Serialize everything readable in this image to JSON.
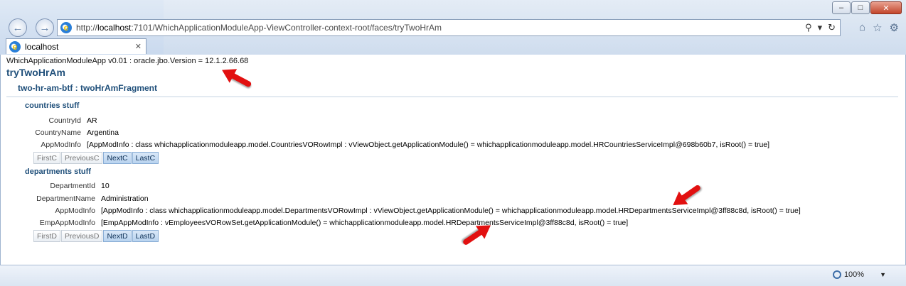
{
  "browser": {
    "url_prefix": "http://",
    "url_host": "localhost",
    "url_rest": ":7101/WhichApplicationModuleApp-ViewController-context-root/faces/tryTwoHrAm",
    "tab_label": "localhost",
    "zoom": "100%"
  },
  "page": {
    "version_line": "WhichApplicationModuleApp v0.01 : oracle.jbo.Version = 12.1.2.66.68",
    "title": "tryTwoHrAm",
    "btf_title": "two-hr-am-btf : twoHrAmFragment"
  },
  "countries": {
    "title": "countries stuff",
    "fields": [
      {
        "label": "CountryId",
        "value": "AR"
      },
      {
        "label": "CountryName",
        "value": "Argentina"
      },
      {
        "label": "AppModInfo",
        "value": "[AppModInfo : class whichapplicationmoduleapp.model.CountriesVORowImpl : vViewObject.getApplicationModule() = whichapplicationmoduleapp.model.HRCountriesServiceImpl@698b60b7, isRoot() = true]"
      }
    ],
    "buttons": [
      "FirstC",
      "PreviousC",
      "NextC",
      "LastC"
    ]
  },
  "departments": {
    "title": "departments stuff",
    "fields": [
      {
        "label": "DepartmentId",
        "value": "10"
      },
      {
        "label": "DepartmentName",
        "value": "Administration"
      },
      {
        "label": "AppModInfo",
        "value": "[AppModInfo : class whichapplicationmoduleapp.model.DepartmentsVORowImpl : vViewObject.getApplicationModule() = whichapplicationmoduleapp.model.HRDepartmentsServiceImpl@3ff88c8d, isRoot() = true]"
      },
      {
        "label": "EmpAppModInfo",
        "value": "[EmpAppModInfo : vEmployeesVORowSet.getApplicationModule() = whichapplicationmoduleapp.model.HRDepartmentsServiceImpl@3ff88c8d, isRoot() = true]"
      }
    ],
    "buttons": [
      "FirstD",
      "PreviousD",
      "NextD",
      "LastD"
    ]
  },
  "colors": {
    "heading": "#1f4f7a",
    "arrow": "#e21010",
    "active_button": "#b9d3ef"
  }
}
